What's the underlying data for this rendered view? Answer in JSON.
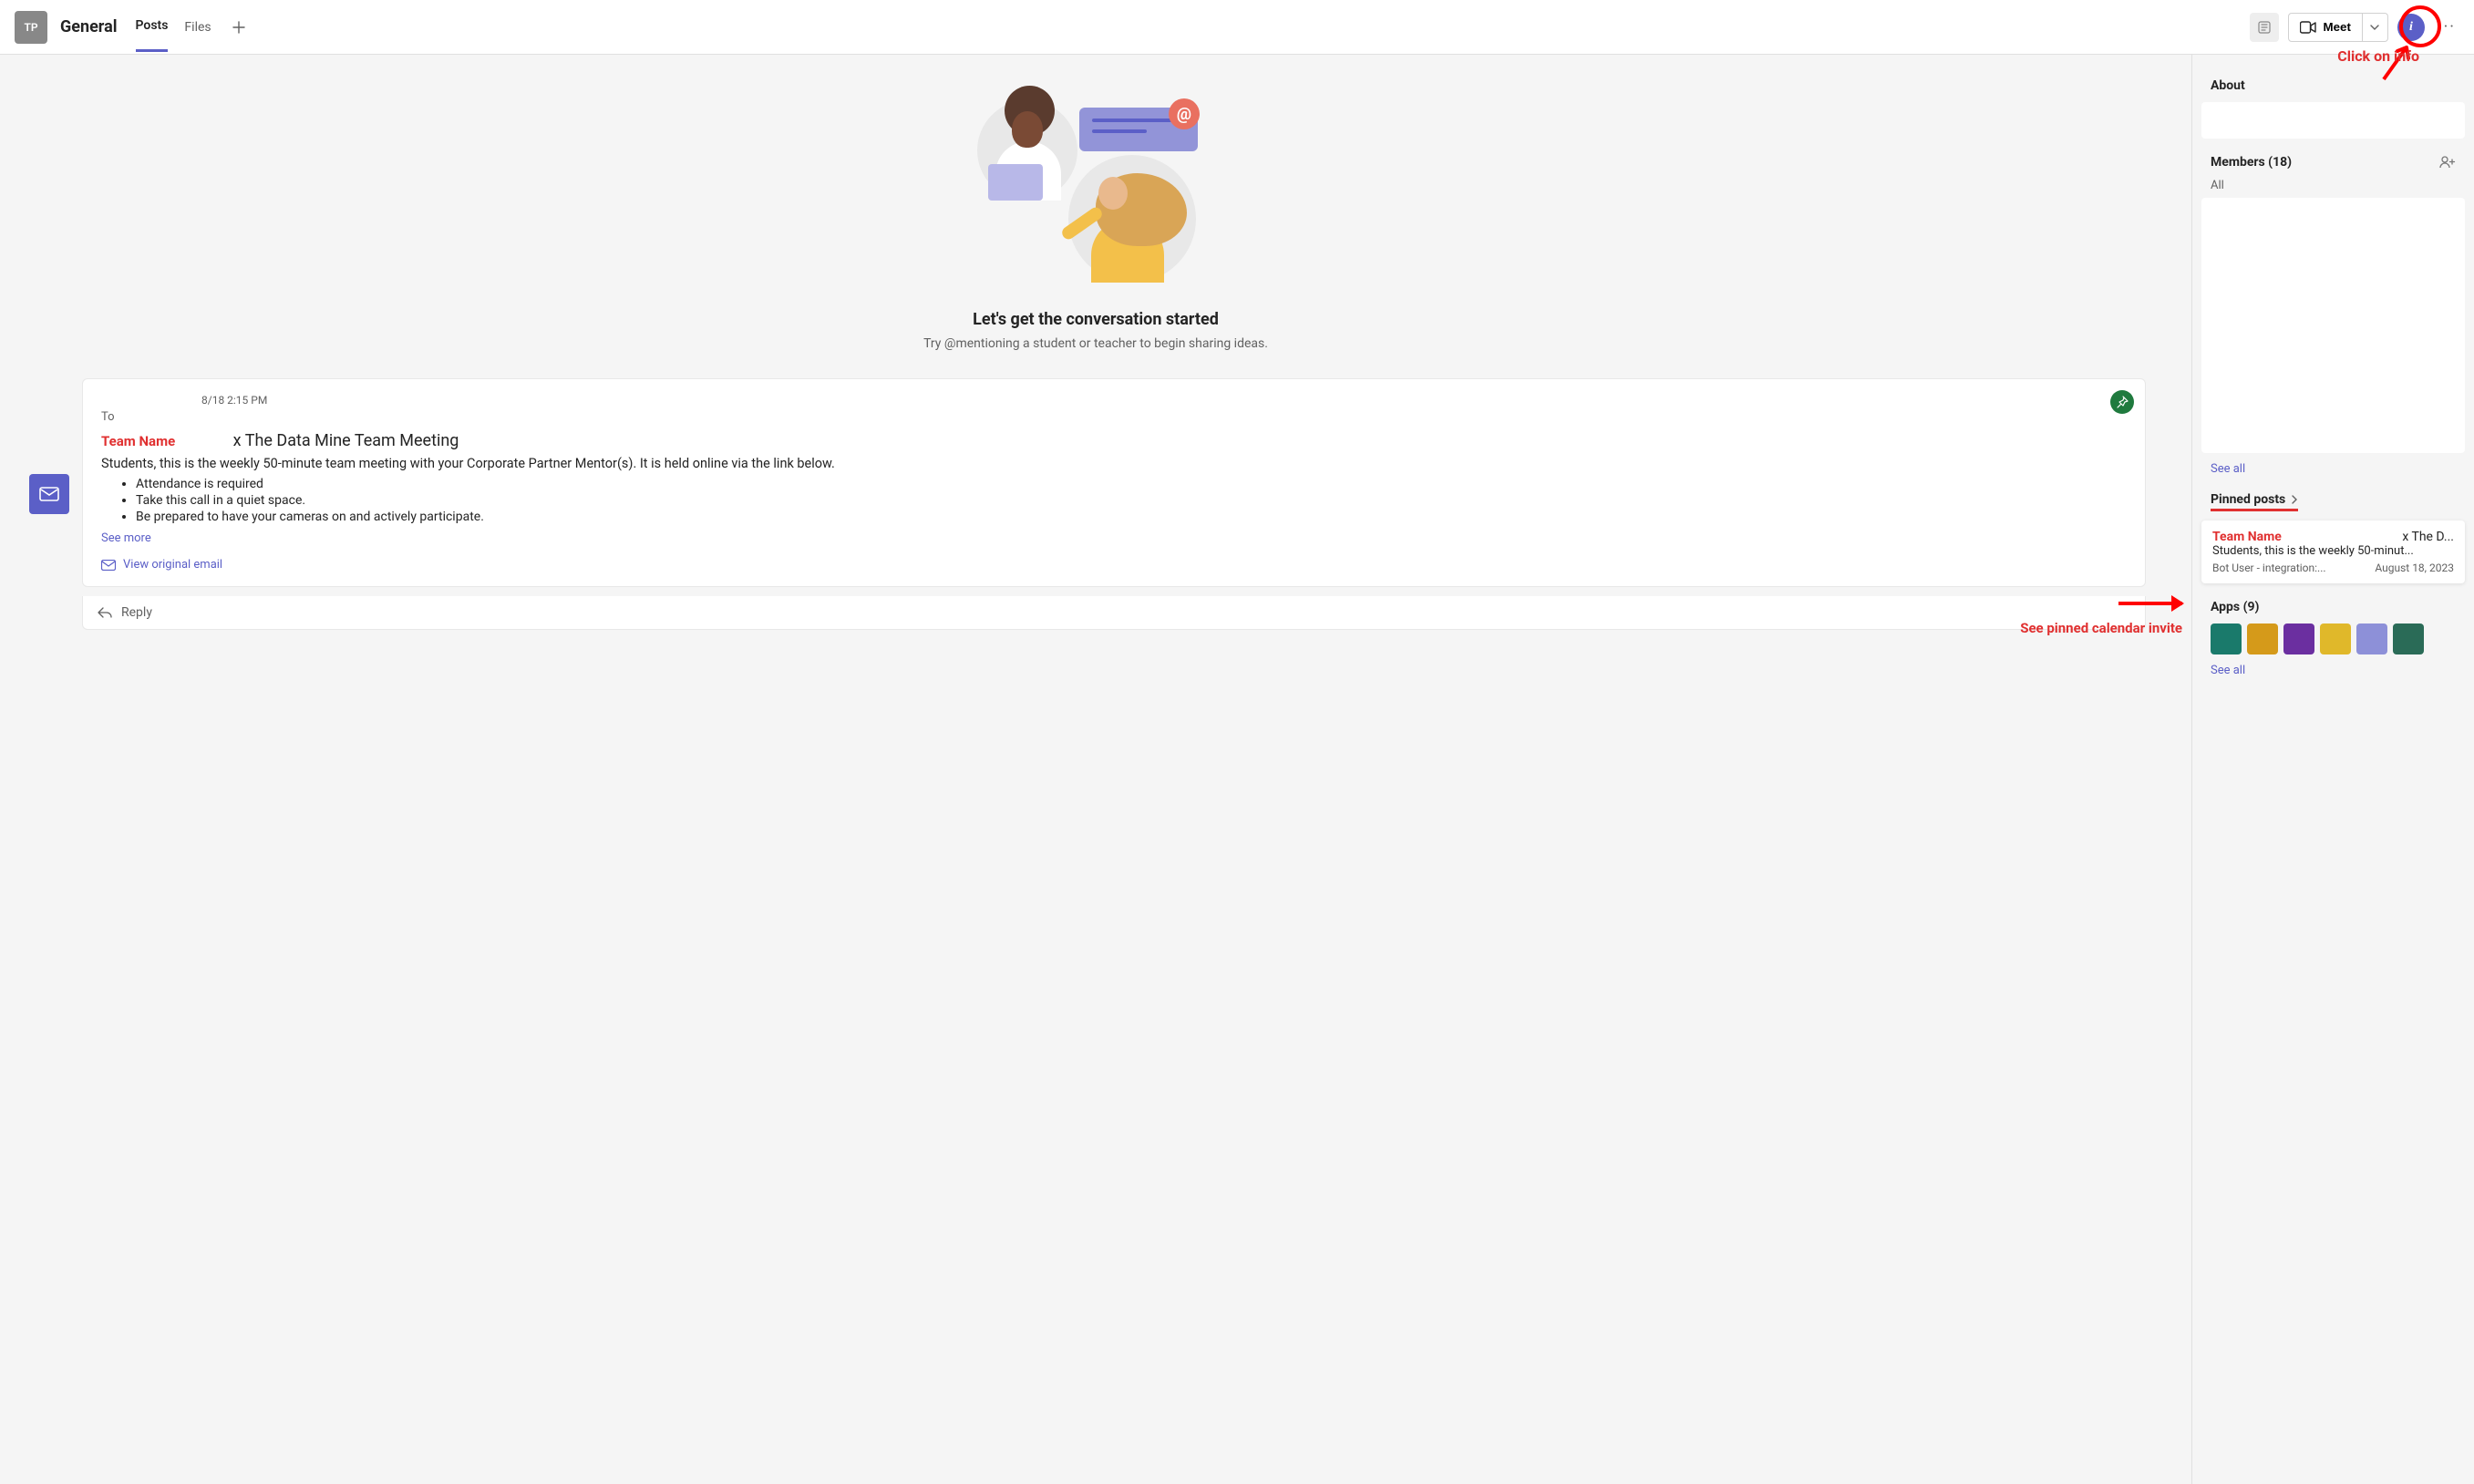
{
  "header": {
    "team_chip": "TP",
    "channel": "General",
    "tabs": {
      "posts": "Posts",
      "files": "Files"
    },
    "meet": "Meet"
  },
  "annotations": {
    "click_info": "Click on info",
    "team_name": "Team Name",
    "see_pinned": "See pinned calendar invite"
  },
  "intro": {
    "heading": "Let's get the conversation started",
    "sub": "Try @mentioning a student or teacher to begin sharing ideas."
  },
  "post": {
    "time": "8/18 2:15 PM",
    "to": "To",
    "title": "x The Data Mine Team Meeting",
    "body": "Students, this is the weekly 50-minute team meeting with your Corporate Partner Mentor(s). It is held online via the link below.",
    "bullets": [
      "Attendance is required",
      "Take this call in a quiet space.",
      "Be prepared to have your cameras on and actively participate."
    ],
    "see_more": "See more",
    "view_original": "View original email",
    "reply": "Reply"
  },
  "side": {
    "about": "About",
    "members": "Members (18)",
    "members_filter": "All",
    "see_all": "See all",
    "pinned": "Pinned posts",
    "pinned_card": {
      "title": "x The D...",
      "preview": "Students, this is the weekly 50-minut...",
      "author": "Bot User - integration:...",
      "date": "August 18, 2023"
    },
    "apps": "Apps (9)"
  },
  "colors": {
    "app_tiles": [
      "#1a7a6b",
      "#d59a1a",
      "#6b2fa0",
      "#e0b82a",
      "#8d90d8",
      "#2a6b57"
    ]
  }
}
